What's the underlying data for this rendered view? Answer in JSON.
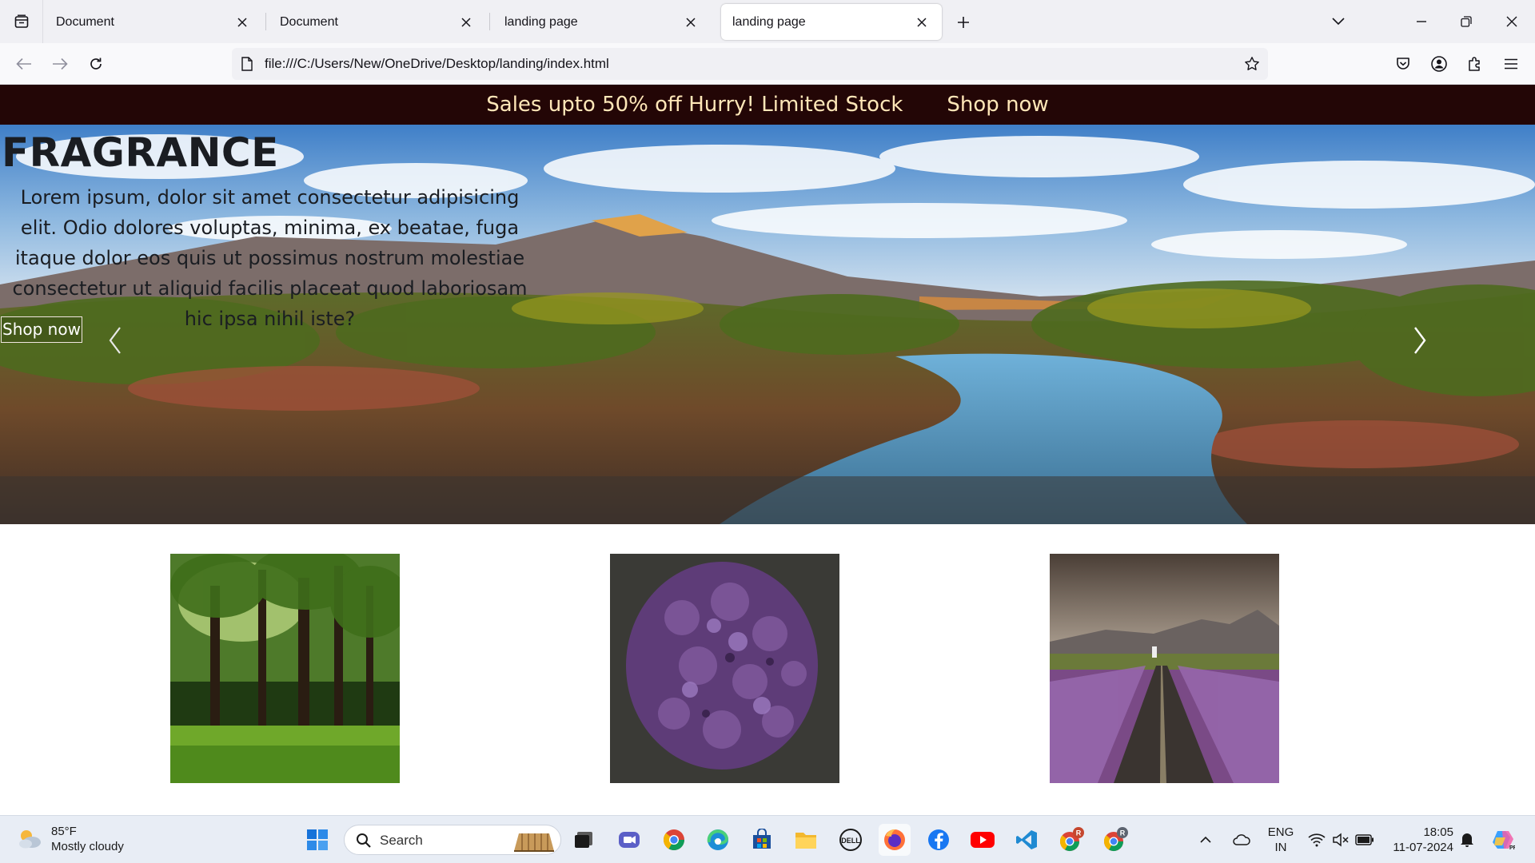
{
  "browser": {
    "tabs": [
      {
        "title": "Document",
        "active": false
      },
      {
        "title": "Document",
        "active": false
      },
      {
        "title": "landing page",
        "active": false
      },
      {
        "title": "landing page",
        "active": true
      }
    ],
    "url": "file:///C:/Users/New/OneDrive/Desktop/landing/index.html"
  },
  "page": {
    "promo": {
      "text": "Sales upto 50% off Hurry! Limited Stock",
      "link": "Shop now"
    },
    "hero": {
      "title": "FRAGRANCE",
      "description": "Lorem ipsum, dolor sit amet consectetur adipisicing elit. Odio dolores voluptas, minima, ex beatae, fuga itaque dolor eos quis ut possimus nostrum molestiae consectetur ut aliquid facilis placeat quod laboriosam hic ipsa nihil iste?",
      "button": "Shop now"
    },
    "cards": [
      {
        "icon": "forest-image"
      },
      {
        "icon": "lilac-flowers-image"
      },
      {
        "icon": "lavender-road-image"
      }
    ]
  },
  "taskbar": {
    "weather": {
      "temp": "85°F",
      "condition": "Mostly cloudy"
    },
    "search_label": "Search",
    "language": {
      "line1": "ENG",
      "line2": "IN"
    },
    "clock": {
      "time": "18:05",
      "date": "11-07-2024"
    }
  }
}
